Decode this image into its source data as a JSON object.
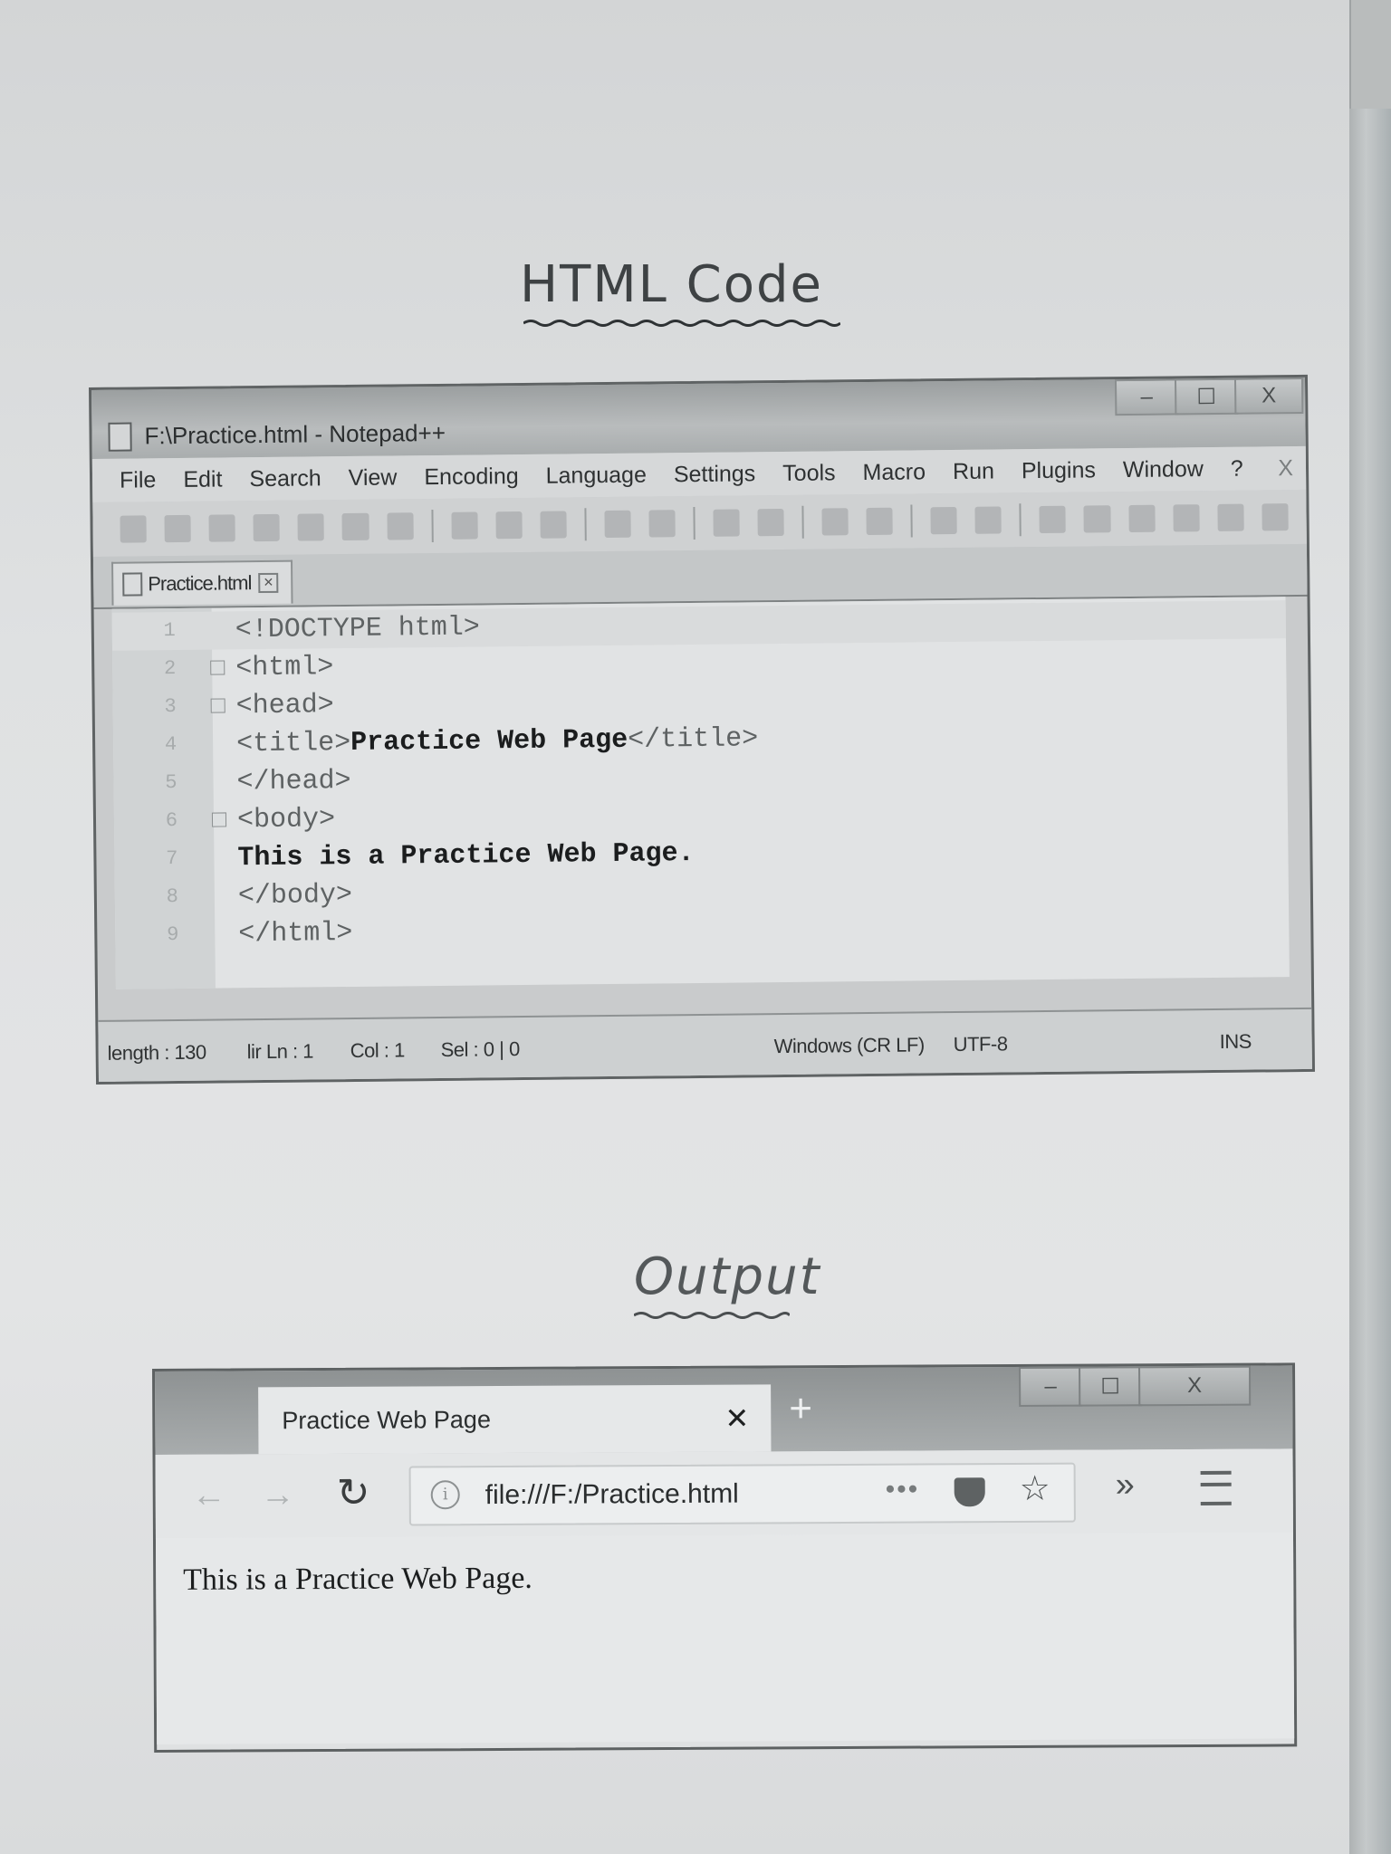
{
  "headings": {
    "code": "HTML Code",
    "output": "Output"
  },
  "notepad": {
    "title": "F:\\Practice.html - Notepad++",
    "controls": [
      "–",
      "☐",
      "X"
    ],
    "menu": [
      "File",
      "Edit",
      "Search",
      "View",
      "Encoding",
      "Language",
      "Settings",
      "Tools",
      "Macro",
      "Run",
      "Plugins",
      "Window",
      "?"
    ],
    "menu_close": "X",
    "tab": {
      "label": "Practice.html",
      "close": "✕"
    },
    "lines": [
      {
        "num": "1",
        "text": "<!DOCTYPE html>"
      },
      {
        "num": "2",
        "text": "<html>"
      },
      {
        "num": "3",
        "text": "<head>"
      },
      {
        "num": "4",
        "pre": "<title>",
        "mid": "Practice Web Page",
        "post": "</title>"
      },
      {
        "num": "5",
        "text": "</head>"
      },
      {
        "num": "6",
        "text": "<body>"
      },
      {
        "num": "7",
        "mid": "This is a Practice Web Page."
      },
      {
        "num": "8",
        "text": "</body>"
      },
      {
        "num": "9",
        "text": "</html>"
      }
    ],
    "status": {
      "length": "length : 130",
      "lines": "lir Ln : 1",
      "col": "Col : 1",
      "sel": "Sel : 0 | 0",
      "eol": "Windows (CR LF)",
      "encoding": "UTF-8",
      "mode": "INS"
    }
  },
  "browser": {
    "tab_title": "Practice Web Page",
    "tab_close": "✕",
    "new_tab": "+",
    "controls": [
      "–",
      "☐",
      "X"
    ],
    "back": "←",
    "forward": "→",
    "reload": "↻",
    "info": "i",
    "url": "file:///F:/Practice.html",
    "more": "•••",
    "star": "☆",
    "overflow": "»",
    "content": "This is a Practice Web Page."
  }
}
